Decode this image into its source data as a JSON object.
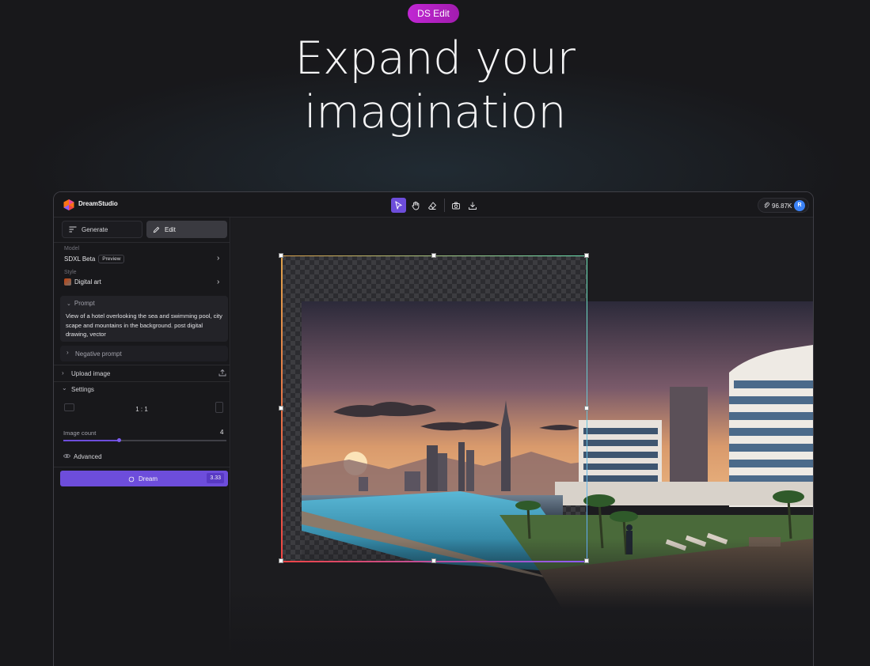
{
  "hero": {
    "badge": "DS Edit",
    "headline_line1": "Expand your",
    "headline_line2": "imagination"
  },
  "app": {
    "brand": "DreamStudio",
    "credits": "96.87K",
    "avatar_initial": "R",
    "toolbar": {
      "tools": [
        "select-arrow-icon",
        "hand-icon",
        "eraser-icon",
        "camera-icon",
        "download-icon"
      ],
      "active_tool": "select-arrow-icon"
    },
    "tabs": {
      "generate": "Generate",
      "edit": "Edit",
      "active": "Edit"
    },
    "model": {
      "label": "Model",
      "value": "SDXL Beta",
      "badge": "Preview"
    },
    "style": {
      "label": "Style",
      "value": "Digital art"
    },
    "prompt": {
      "title": "Prompt",
      "text": "View of a hotel overlooking the sea and swimming pool, city scape and mountains in the background. post digital drawing, vector"
    },
    "negative_prompt": {
      "title": "Negative prompt"
    },
    "upload_image": {
      "label": "Upload image"
    },
    "settings": {
      "label": "Settings",
      "aspect_ratio": "1 : 1",
      "image_count_label": "Image count",
      "image_count_value": "4",
      "image_count_fraction": 0.34
    },
    "advanced": {
      "label": "Advanced"
    },
    "dream_button": {
      "label": "Dream",
      "cost": "3.33"
    },
    "colors": {
      "accent": "#6d4ddb",
      "badge": "#c026d3",
      "background": "#18181b"
    }
  }
}
